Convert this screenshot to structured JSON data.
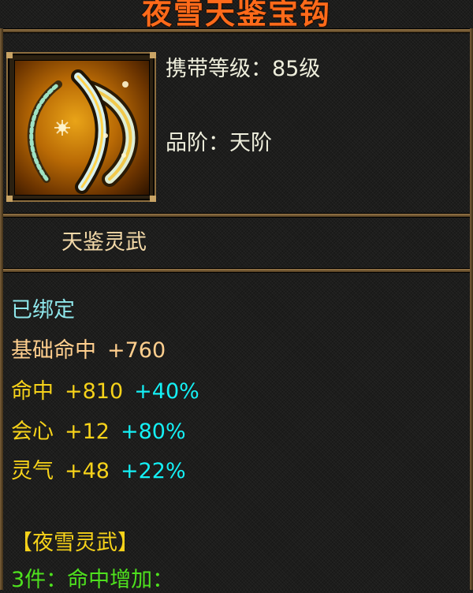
{
  "item": {
    "title": "夜雪天鉴宝钩",
    "level_label": "携带等级：",
    "level_value": "85级",
    "grade_label": "品阶：",
    "grade_value": "天阶",
    "type": "天鉴灵武",
    "icon": "golden-hook-weapon-icon"
  },
  "stats": {
    "bound": "已绑定",
    "base": {
      "name": "基础命中",
      "value": "+760"
    },
    "lines": [
      {
        "name": "命中",
        "value": "+810",
        "percent": "+40%"
      },
      {
        "name": "会心",
        "value": "+12",
        "percent": "+80%"
      },
      {
        "name": "灵气",
        "value": "+48",
        "percent": "+22%"
      }
    ]
  },
  "set": {
    "name": "【夜雪灵武】",
    "bonus": "3件：命中增加："
  },
  "colors": {
    "title": "#ff6a1a",
    "bound": "#8ee6ea",
    "base": "#ffcf8e",
    "stat": "#f6d21a",
    "percent": "#14f0f5",
    "set": "#4ee11e"
  }
}
